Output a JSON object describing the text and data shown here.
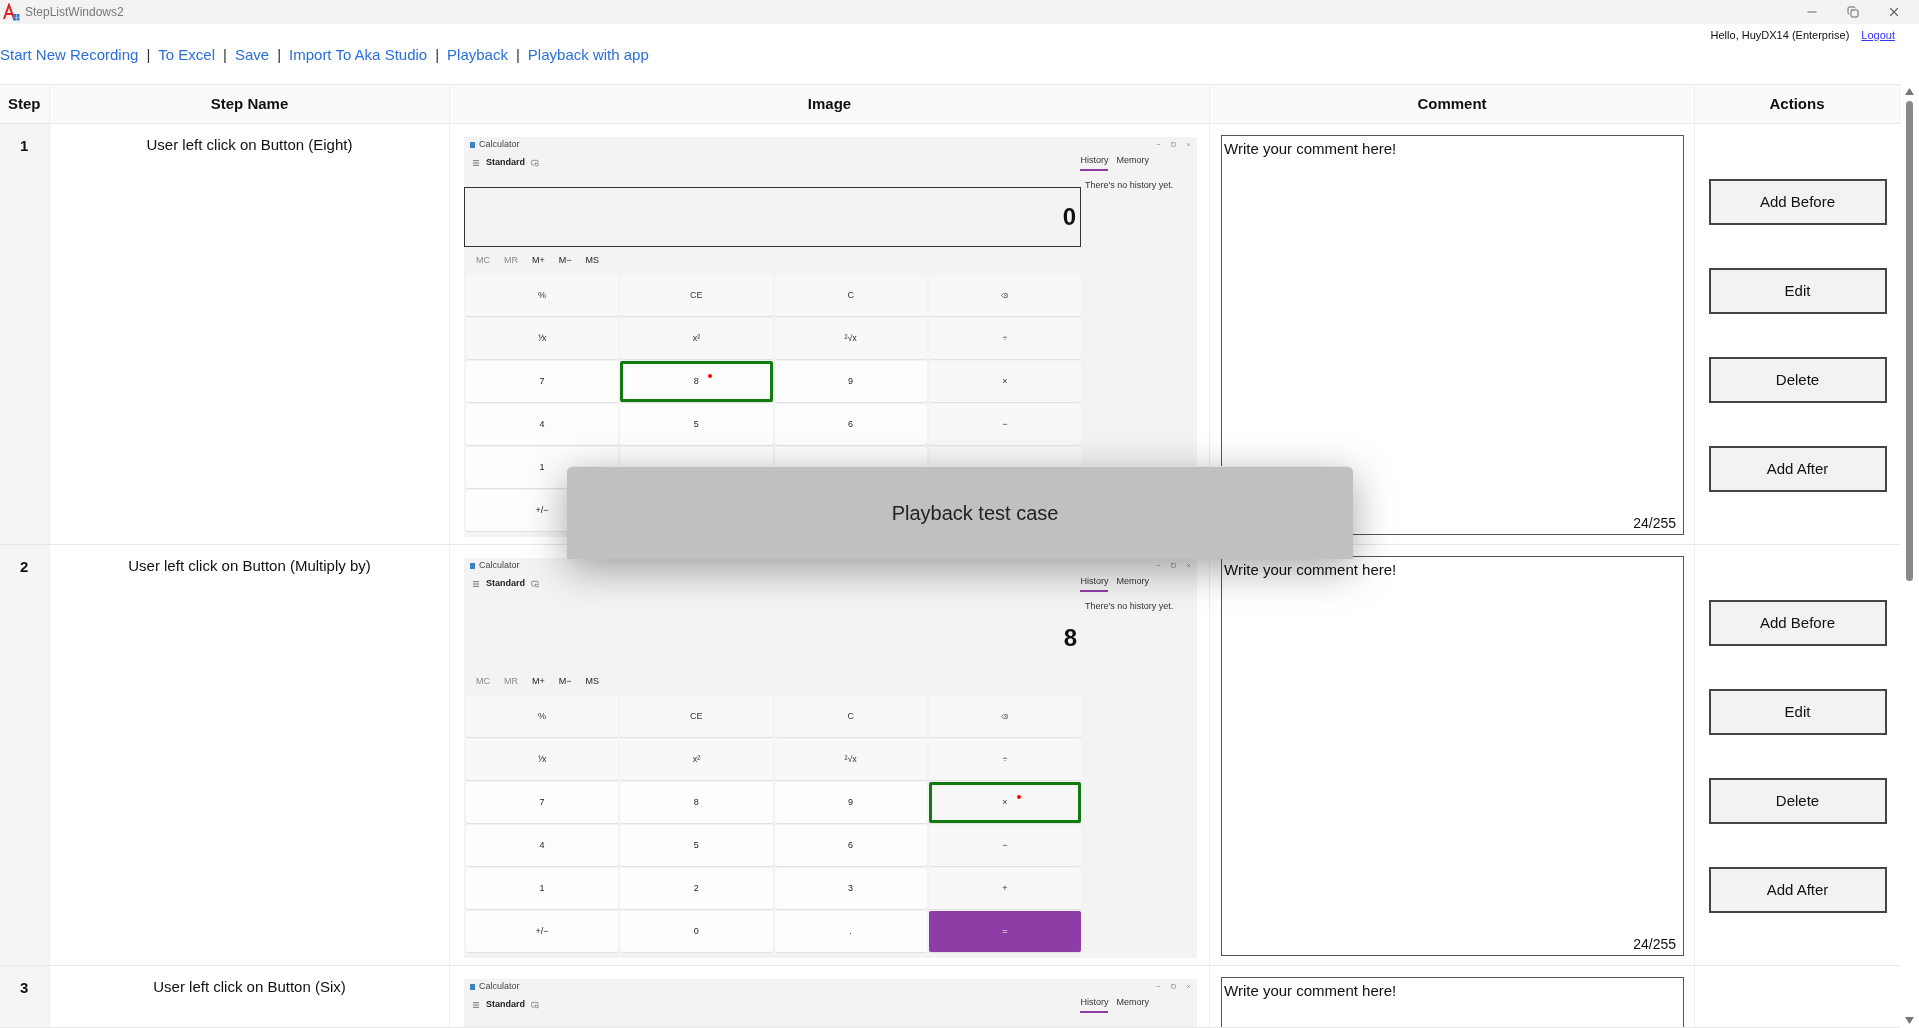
{
  "window": {
    "title": "StepListWindows2"
  },
  "user": {
    "greeting": "Hello, HuyDX14 (Enterprise)",
    "logout": "Logout"
  },
  "toolbar": {
    "links": [
      "Start New Recording",
      "To Excel",
      "Save",
      "Import To Aka Studio",
      "Playback",
      "Playback with app"
    ],
    "separators": [
      "|",
      "|",
      "|",
      "|",
      "|"
    ]
  },
  "table": {
    "columns": [
      "Step",
      "Step Name",
      "Image",
      "Comment",
      "Actions"
    ],
    "rows": [
      {
        "step": "1",
        "name": "User left click on Button (Eight)",
        "comment": "Write your comment here!",
        "counter": "24/255",
        "actions": [
          "Add Before",
          "Edit",
          "Delete",
          "Add After"
        ],
        "image": {
          "title": "Calculator",
          "mode": "Standard",
          "tabs": [
            {
              "label": "History",
              "selected": true
            },
            {
              "label": "Memory",
              "selected": false
            }
          ],
          "history_note": "There's no history yet.",
          "display": {
            "value": "0",
            "focused": true
          },
          "memory": [
            {
              "label": "MC",
              "disabled": true
            },
            {
              "label": "MR",
              "disabled": true
            },
            {
              "label": "M+",
              "disabled": false
            },
            {
              "label": "M−",
              "disabled": false
            },
            {
              "label": "MS",
              "disabled": false
            }
          ],
          "keys": [
            [
              {
                "kind": "fn",
                "label": "%",
                "highlighted": false
              },
              {
                "kind": "fn",
                "label": "CE",
                "highlighted": false
              },
              {
                "kind": "fn",
                "label": "C",
                "highlighted": false
              },
              {
                "kind": "backspace",
                "highlighted": false
              }
            ],
            [
              {
                "kind": "fn",
                "label": "⅟x",
                "highlighted": false
              },
              {
                "kind": "fn",
                "label": "x²",
                "highlighted": false
              },
              {
                "kind": "fn",
                "label": "²√x",
                "highlighted": false
              },
              {
                "kind": "fn",
                "label": "÷",
                "highlighted": false
              }
            ],
            [
              {
                "kind": "digit",
                "label": "7",
                "highlighted": false
              },
              {
                "kind": "digit",
                "label": "8",
                "highlighted": true
              },
              {
                "kind": "digit",
                "label": "9",
                "highlighted": false
              },
              {
                "kind": "fn",
                "label": "×",
                "highlighted": false
              }
            ],
            [
              {
                "kind": "digit",
                "label": "4",
                "highlighted": false
              },
              {
                "kind": "digit",
                "label": "5",
                "highlighted": false
              },
              {
                "kind": "digit",
                "label": "6",
                "highlighted": false
              },
              {
                "kind": "fn",
                "label": "−",
                "highlighted": false
              }
            ],
            [
              {
                "kind": "digit",
                "label": "1",
                "highlighted": false
              },
              {
                "kind": "digit",
                "highlighted": false
              },
              {
                "kind": "digit",
                "highlighted": false
              },
              {
                "kind": "fn",
                "highlighted": false
              }
            ],
            [
              {
                "kind": "digit",
                "label": "+/−",
                "highlighted": false
              }
            ]
          ]
        }
      },
      {
        "step": "2",
        "name": "User left click on Button (Multiply by)",
        "comment": "Write your comment here!",
        "counter": "24/255",
        "actions": [
          "Add Before",
          "Edit",
          "Delete",
          "Add After"
        ],
        "image": {
          "title": "Calculator",
          "mode": "Standard",
          "tabs": [
            {
              "label": "History",
              "selected": true
            },
            {
              "label": "Memory",
              "selected": false
            }
          ],
          "history_note": "There's no history yet.",
          "display": {
            "value": "8",
            "focused": false
          },
          "memory": [
            {
              "label": "MC",
              "disabled": true
            },
            {
              "label": "MR",
              "disabled": true
            },
            {
              "label": "M+",
              "disabled": false
            },
            {
              "label": "M−",
              "disabled": false
            },
            {
              "label": "MS",
              "disabled": false
            }
          ],
          "keys": [
            [
              {
                "kind": "fn",
                "label": "%",
                "highlighted": false
              },
              {
                "kind": "fn",
                "label": "CE",
                "highlighted": false
              },
              {
                "kind": "fn",
                "label": "C",
                "highlighted": false
              },
              {
                "kind": "backspace",
                "highlighted": false
              }
            ],
            [
              {
                "kind": "fn",
                "label": "⅟x",
                "highlighted": false
              },
              {
                "kind": "fn",
                "label": "x²",
                "highlighted": false
              },
              {
                "kind": "fn",
                "label": "²√x",
                "highlighted": false
              },
              {
                "kind": "fn",
                "label": "÷",
                "highlighted": false
              }
            ],
            [
              {
                "kind": "digit",
                "label": "7",
                "highlighted": false
              },
              {
                "kind": "digit",
                "label": "8",
                "highlighted": false
              },
              {
                "kind": "digit",
                "label": "9",
                "highlighted": false
              },
              {
                "kind": "fn",
                "label": "×",
                "highlighted": true
              }
            ],
            [
              {
                "kind": "digit",
                "label": "4",
                "highlighted": false
              },
              {
                "kind": "digit",
                "label": "5",
                "highlighted": false
              },
              {
                "kind": "digit",
                "label": "6",
                "highlighted": false
              },
              {
                "kind": "fn",
                "label": "−",
                "highlighted": false
              }
            ],
            [
              {
                "kind": "digit",
                "label": "1",
                "highlighted": false
              },
              {
                "kind": "digit",
                "label": "2",
                "highlighted": false
              },
              {
                "kind": "digit",
                "label": "3",
                "highlighted": false
              },
              {
                "kind": "fn",
                "label": "+",
                "highlighted": false
              }
            ],
            [
              {
                "kind": "digit",
                "label": "+/−",
                "highlighted": false
              },
              {
                "kind": "digit",
                "label": "0",
                "highlighted": false
              },
              {
                "kind": "digit",
                "label": ".",
                "highlighted": false
              },
              {
                "kind": "equals",
                "label": "=",
                "highlighted": false
              }
            ]
          ]
        }
      },
      {
        "step": "3",
        "name": "User left click on Button (Six)",
        "comment": "Write your comment here!",
        "image": {
          "title": "Calculator",
          "mode": "Standard",
          "tabs": [
            {
              "label": "History",
              "selected": true
            },
            {
              "label": "Memory",
              "selected": false
            }
          ]
        }
      }
    ]
  },
  "dialog": {
    "message": "Playback test case"
  }
}
